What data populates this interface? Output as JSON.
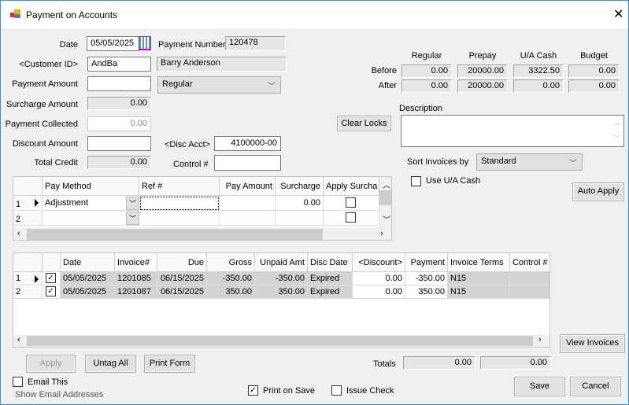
{
  "window": {
    "title": "Payment on Accounts",
    "close_icon": "close-icon",
    "app_icon": "app-icon"
  },
  "form": {
    "date_label": "Date",
    "date_value": "05/05/2025",
    "payment_number_label": "Payment Number",
    "payment_number": "120478",
    "customer_id_label": "<Customer ID>",
    "customer_id": "AndBa",
    "customer_name": "Barry Anderson",
    "payment_amount_label": "Payment Amount",
    "payment_amount": "",
    "payment_type": "Regular",
    "surcharge_amount_label": "Surcharge Amount",
    "surcharge_amount": "0.00",
    "payment_collected_label": "Payment Collected",
    "payment_collected": "0.00",
    "discount_amount_label": "Discount Amount",
    "discount_amount": "",
    "disc_acct_label": "<Disc Acct>",
    "disc_acct": "4100000-00",
    "total_credit_label": "Total Credit",
    "total_credit": "0.00",
    "control_label": "Control #",
    "control": ""
  },
  "balances": {
    "columns": [
      "Regular",
      "Prepay",
      "U/A Cash",
      "Budget"
    ],
    "rows": [
      {
        "label": "Before",
        "values": [
          "0.00",
          "20000.00",
          "3322.50",
          "0.00"
        ]
      },
      {
        "label": "After",
        "values": [
          "0.00",
          "20000.00",
          "0.00",
          "0.00"
        ]
      }
    ]
  },
  "clear_locks": "Clear Locks",
  "description_label": "Description",
  "description": "",
  "sort_label": "Sort Invoices by",
  "sort_value": "Standard",
  "use_ua_cash": {
    "label": "Use U/A Cash",
    "checked": false
  },
  "auto_apply": "Auto Apply",
  "pay_grid": {
    "columns": [
      "",
      "Pay Method",
      "Ref #",
      "Pay Amount",
      "Surcharge",
      "Apply Surcha"
    ],
    "rows": [
      [
        "1",
        "Adjustment",
        "",
        "",
        "0.00",
        false
      ],
      [
        "2",
        "",
        "",
        "",
        "",
        false
      ]
    ]
  },
  "invoice_grid": {
    "columns": [
      "",
      "",
      "Date",
      "Invoice#",
      "Due",
      "Gross",
      "Unpaid Amt",
      "Disc Date",
      "<Discount>",
      "Payment",
      "Invoice Terms",
      "Control #"
    ],
    "rows": [
      [
        "1",
        true,
        "05/05/2025",
        "1201085",
        "06/15/2025",
        "-350.00",
        "-350.00",
        "Expired",
        "0.00",
        "-350.00",
        "N15",
        ""
      ],
      [
        "2",
        true,
        "05/05/2025",
        "1201087",
        "06/15/2025",
        "350.00",
        "350.00",
        "Expired",
        "0.00",
        "350.00",
        "N15",
        ""
      ]
    ]
  },
  "view_invoices": "View Invoices",
  "apply": "Apply",
  "untag_all": "Untag All",
  "print_form": "Print Form",
  "totals_label": "Totals",
  "totals": [
    "0.00",
    "0.00"
  ],
  "email_this": {
    "label": "Email This",
    "checked": false
  },
  "show_email": "Show Email Addresses",
  "print_on_save": {
    "label": "Print on Save",
    "checked": true
  },
  "issue_check": {
    "label": "Issue Check",
    "checked": false
  },
  "save": "Save",
  "cancel": "Cancel"
}
